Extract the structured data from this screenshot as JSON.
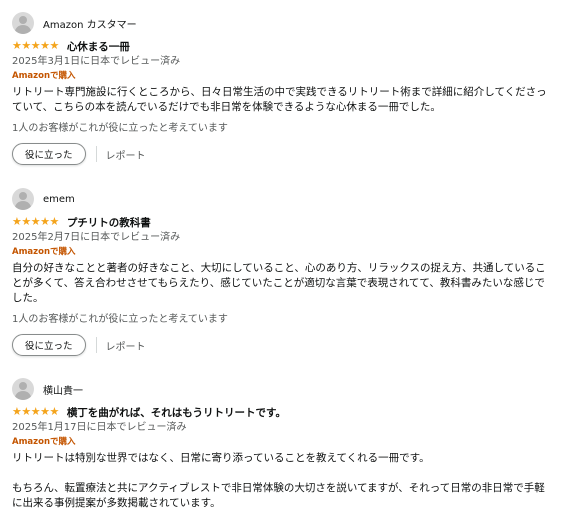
{
  "colors": {
    "star": "#f4a41c",
    "verified": "#c45500",
    "muted": "#565959",
    "text": "#0f1111"
  },
  "reviews": [
    {
      "profile_name": "Amazon カスタマー",
      "stars": "★★★★★",
      "rating": 5,
      "title": "心休まる一冊",
      "date": "2025年3月1日に日本でレビュー済み",
      "verified": "Amazonで購入",
      "body": [
        "リトリート専門施設に行くところから、日々日常生活の中で実践できるリトリート術まで詳細に紹介してくださっていて、こちらの本を読んでいるだけでも非日常を体験できるような心休まる一冊でした。"
      ],
      "helpful_count": "1人のお客様がこれが役に立ったと考えています",
      "helpful_button": "役に立った",
      "report_link": "レポート"
    },
    {
      "profile_name": "emem",
      "stars": "★★★★★",
      "rating": 5,
      "title": "プチリトの教科書",
      "date": "2025年2月7日に日本でレビュー済み",
      "verified": "Amazonで購入",
      "body": [
        "自分の好きなことと著者の好きなこと、大切にしていること、心のあり方、リラックスの捉え方、共通していることが多くて、答え合わせさせてもらえたり、感じていたことが適切な言葉で表現されてて、教科書みたいな感じでした。"
      ],
      "helpful_count": "1人のお客様がこれが役に立ったと考えています",
      "helpful_button": "役に立った",
      "report_link": "レポート"
    },
    {
      "profile_name": "横山貴一",
      "stars": "★★★★★",
      "rating": 5,
      "title": "横丁を曲がれば、それはもうリトリートです。",
      "date": "2025年1月17日に日本でレビュー済み",
      "verified": "Amazonで購入",
      "body": [
        "リトリートは特別な世界ではなく、日常に寄り添っていることを教えてくれる一冊です。",
        "もちろん、転置療法と共にアクティブレストで非日常体験の大切さを説いてますが、それって日常の非日常で手軽に出来る事例提案が多数掲載されています。"
      ]
    }
  ]
}
